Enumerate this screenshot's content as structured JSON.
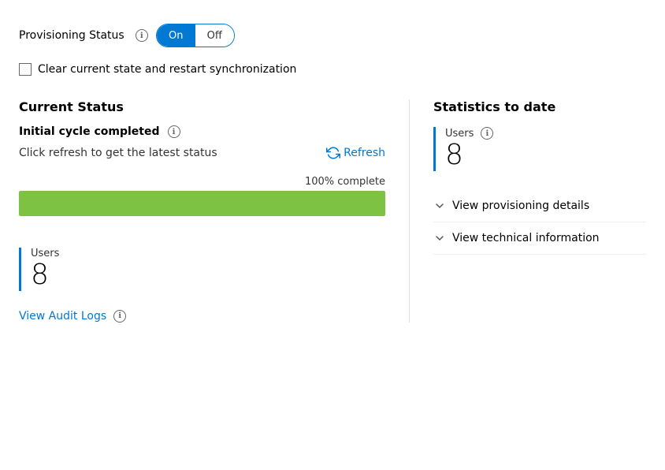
{
  "provisioning": {
    "label": "Provisioning Status",
    "toggle_on_label": "On",
    "toggle_off_label": "Off",
    "info_icon": "ℹ"
  },
  "checkbox": {
    "label": "Clear current state and restart synchronization",
    "checked": false
  },
  "current_status": {
    "section_title": "Current Status",
    "status_line": "Initial cycle completed",
    "refresh_hint": "Click refresh to get the latest status",
    "refresh_label": "Refresh",
    "progress_percent": "100% complete",
    "progress_value": 100
  },
  "bottom_stats": {
    "label": "Users",
    "value": "8",
    "audit_link": "View Audit Logs",
    "info_icon": "ℹ"
  },
  "right_panel": {
    "title": "Statistics to date",
    "users_label": "Users",
    "users_info": "ℹ",
    "users_value": "8",
    "expand_items": [
      {
        "label": "View provisioning details"
      },
      {
        "label": "View technical information"
      }
    ]
  },
  "icons": {
    "info": "ℹ",
    "chevron_down": "∨"
  }
}
